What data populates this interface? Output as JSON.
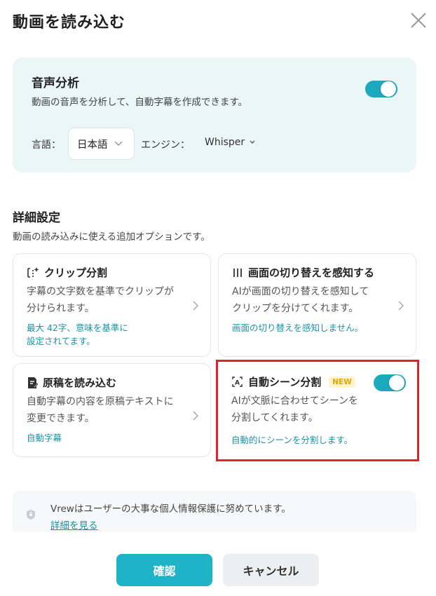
{
  "dialog": {
    "title": "動画を読み込む"
  },
  "audio_analysis": {
    "title": "音声分析",
    "description": "動画の音声を分析して、自動字幕を作成できます。",
    "toggle_on": true,
    "language_label": "言語：",
    "language_value": "日本語",
    "engine_label": "エンジン：",
    "engine_value": "Whisper"
  },
  "advanced": {
    "title": "詳細設定",
    "description": "動画の読み込みに使える追加オプションです。",
    "cards": [
      {
        "icon": "clip-split-icon",
        "title": "クリップ分割",
        "desc_line1": "字幕の文字数を基準でクリップが",
        "desc_line2": "分けられます。",
        "status_line1": "最大 42字、意味を基準に",
        "status_line2": "設定されてます。"
      },
      {
        "icon": "scene-change-icon",
        "title": "画面の切り替えを感知する",
        "desc_line1": "AIが画面の切り替えを感知して",
        "desc_line2": "クリップを分けてくれます。",
        "status_line1": "画面の切り替えを感知しません。"
      },
      {
        "icon": "script-import-icon",
        "title": "原稿を読み込む",
        "desc_line1": "自動字幕の内容を原稿テキストに",
        "desc_line2": "変更できます。",
        "status_line1": "自動字幕"
      },
      {
        "icon": "auto-scene-icon",
        "title": "自動シーン分割",
        "badge": "NEW",
        "toggle_on": true,
        "desc_line1": "AIが文脈に合わせてシーンを",
        "desc_line2": "分割してくれます。",
        "status_line1": "自動的にシーンを分割します。"
      }
    ]
  },
  "privacy": {
    "text": "Vrewはユーザーの大事な個人情報保護に努めています。",
    "link": "詳細を見る"
  },
  "buttons": {
    "confirm": "確認",
    "cancel": "キャンセル"
  },
  "colors": {
    "accent": "#1fb3c8",
    "status_text": "#1a93a6",
    "highlight": "#e0232a",
    "badge": "#e8a300"
  }
}
